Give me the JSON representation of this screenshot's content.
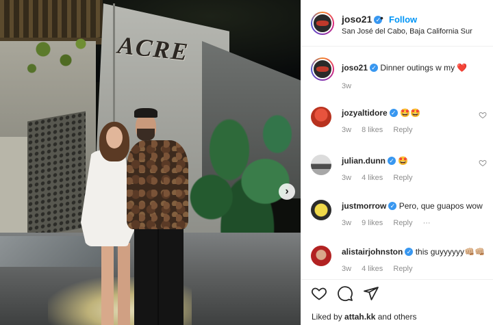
{
  "post": {
    "sign_text": "ACRE",
    "next_arrow": "›"
  },
  "header": {
    "username": "joso21",
    "verified_mark": "✓",
    "separator": "•",
    "follow_label": "Follow",
    "location": "San José del Cabo, Baja California Sur"
  },
  "caption": {
    "username": "joso21",
    "text": "Dinner outings w my ❤️",
    "age": "3w"
  },
  "comments": [
    {
      "username": "jozyaltidore",
      "text": "🤩🤩",
      "age": "3w",
      "likes": "8 likes",
      "reply": "Reply",
      "more": ""
    },
    {
      "username": "julian.dunn",
      "text": "🤩",
      "age": "3w",
      "likes": "4 likes",
      "reply": "Reply",
      "more": ""
    },
    {
      "username": "justmorrow",
      "text": "Pero, que guapos wow",
      "age": "3w",
      "likes": "9 likes",
      "reply": "Reply",
      "more": "···"
    },
    {
      "username": "alistairjohnston",
      "text": "this guyyyyyy👊🏼👊🏼",
      "age": "3w",
      "likes": "4 likes",
      "reply": "Reply",
      "more": ""
    }
  ],
  "actions": {
    "like_icon": "heart-outline-icon",
    "comment_icon": "comment-icon",
    "share_icon": "paper-plane-icon"
  },
  "likes": {
    "prefix": "Liked by",
    "user": "attah.kk",
    "suffix": "and others"
  },
  "colors": {
    "accent": "#0095f6",
    "verified": "#3897f0",
    "text": "#262626",
    "muted": "#8e8e8e"
  }
}
